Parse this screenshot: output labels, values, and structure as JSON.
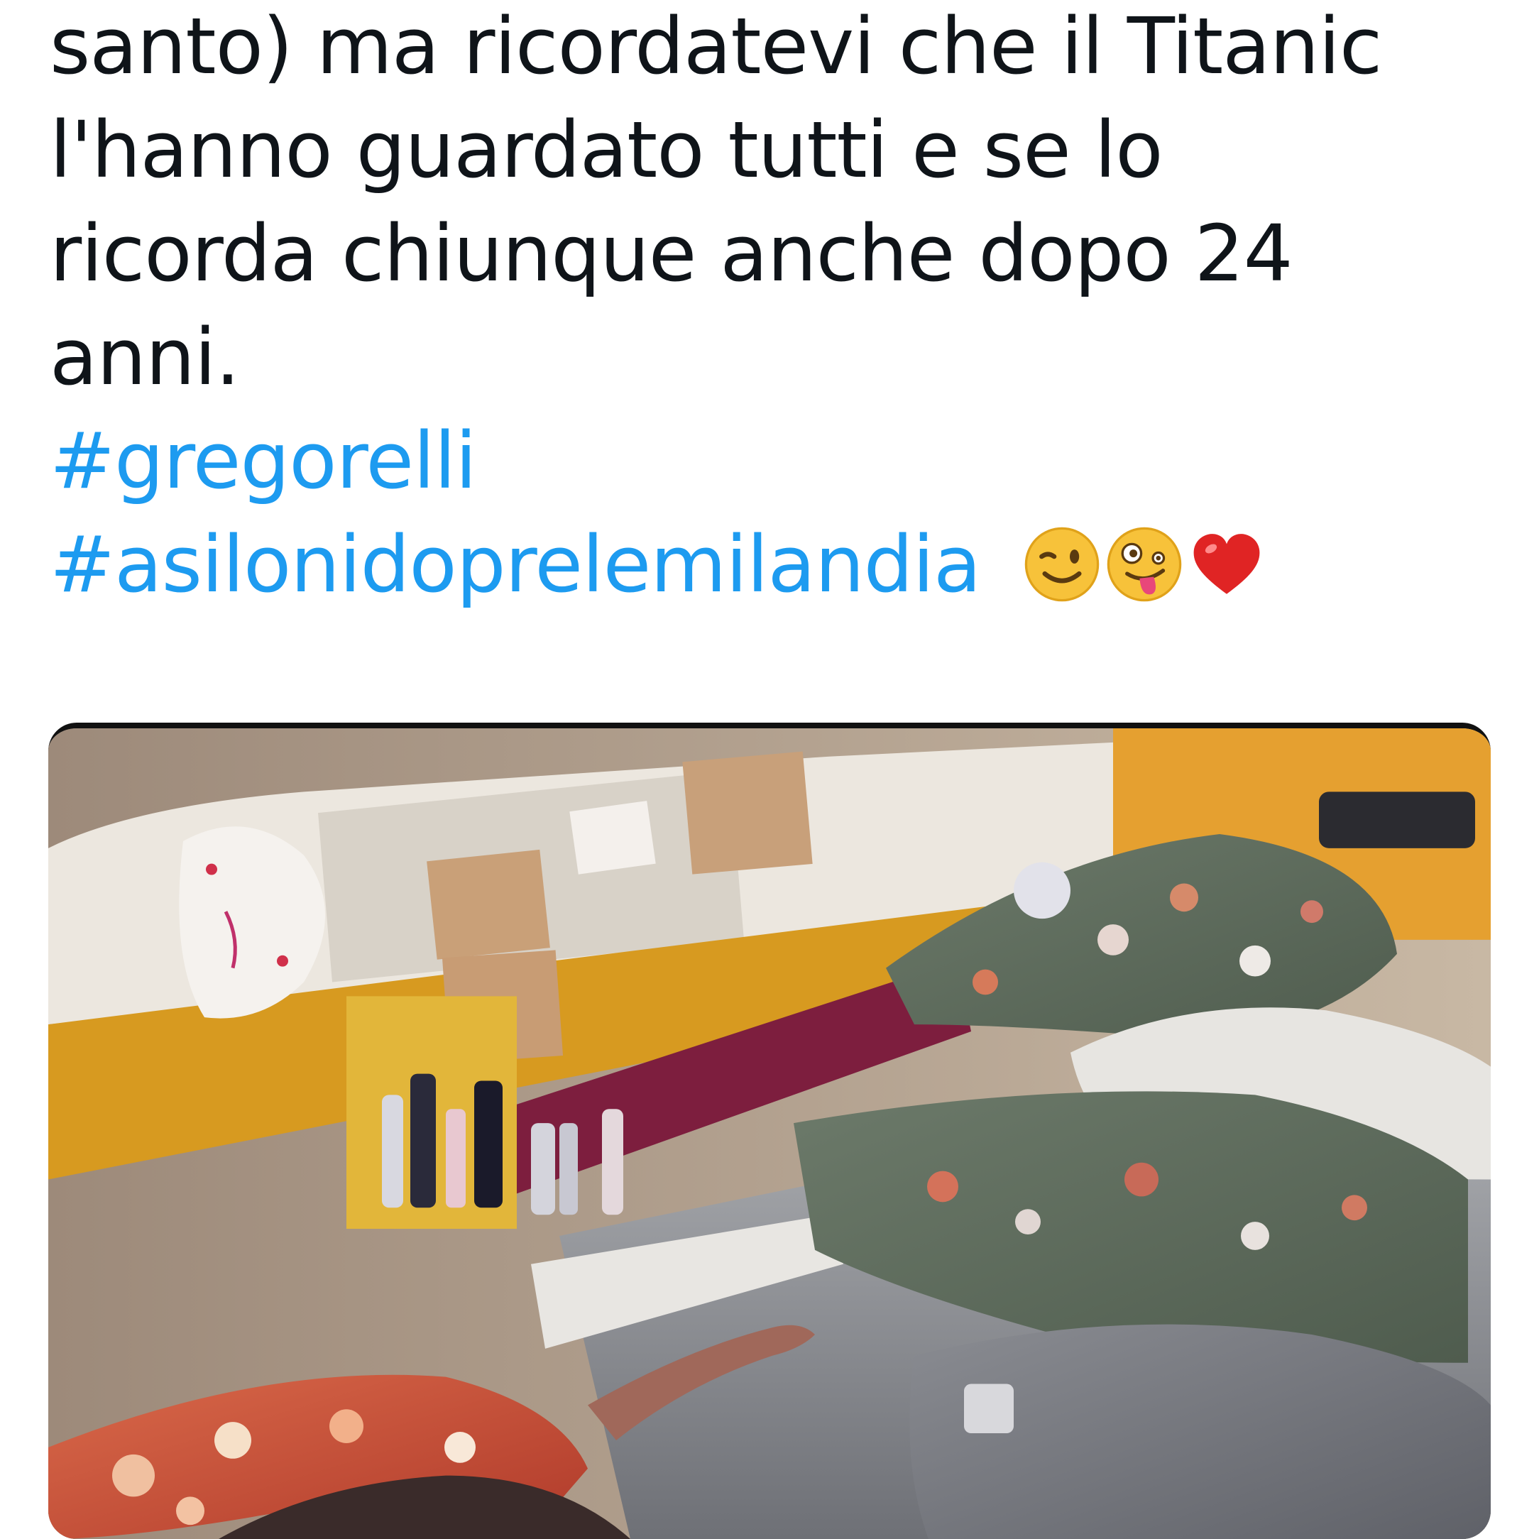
{
  "tweet": {
    "lines": [
      "santo) ma ricordatevi che il Titanic",
      "l'hanno guardato tutti e se lo",
      "ricorda chiunque anche dopo 24",
      "anni."
    ],
    "hashtags": [
      "#gregorelli",
      "#asilonidoprelemilandia"
    ],
    "emojis": [
      "😉",
      "🤪",
      "❤️"
    ]
  },
  "media": {
    "icon": "photo-media"
  },
  "colors": {
    "text": "#0f1419",
    "link": "#1d9bf0",
    "background": "#ffffff"
  }
}
